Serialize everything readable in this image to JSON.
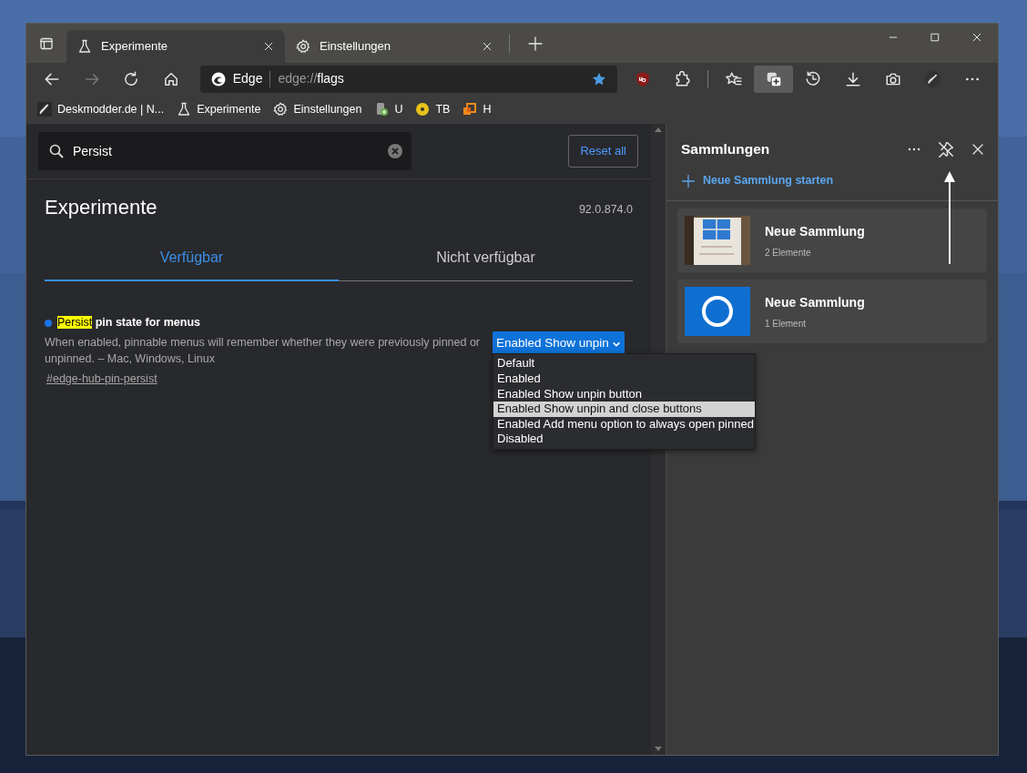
{
  "window": {
    "tabs": [
      {
        "label": "Experimente",
        "selected": true
      },
      {
        "label": "Einstellungen",
        "selected": false
      }
    ]
  },
  "toolbar": {
    "brand": "Edge",
    "url_prefix": "edge://",
    "url_path": "flags",
    "favorite": true,
    "collections_active": true
  },
  "bookmarks": [
    {
      "label": "Deskmodder.de | N..."
    },
    {
      "label": "Experimente"
    },
    {
      "label": "Einstellungen"
    },
    {
      "label": "U"
    },
    {
      "label": "TB"
    },
    {
      "label": "H"
    }
  ],
  "flags": {
    "search": {
      "value": "Persist"
    },
    "reset": "Reset all",
    "title": "Experimente",
    "version": "92.0.874.0",
    "tabs": [
      {
        "label": "Verfügbar",
        "selected": true
      },
      {
        "label": "Nicht verfügbar",
        "selected": false
      }
    ],
    "experiment": {
      "color": "#1a73e8",
      "title_parts": [
        {
          "text": "Persist",
          "highlighted": true
        },
        {
          "text": " pin state for menus",
          "highlighted": false
        }
      ],
      "description": "When enabled, pinnable menus will remember whether they were previously pinned or unpinned. – Mac, Windows, Linux",
      "link": "#edge-hub-pin-persist",
      "select_value": "Enabled Show unpin",
      "options": [
        {
          "label": "Default",
          "selected": false
        },
        {
          "label": "Enabled",
          "selected": false
        },
        {
          "label": "Enabled Show unpin button",
          "selected": false
        },
        {
          "label": "Enabled Show unpin and close buttons",
          "selected": true
        },
        {
          "label": "Enabled Add menu option to always open pinned",
          "selected": false
        },
        {
          "label": "Disabled",
          "selected": false
        }
      ]
    }
  },
  "sidebar": {
    "title": "Sammlungen",
    "new_collection": "Neue Sammlung starten",
    "pinned": false,
    "collections": [
      {
        "name": "Neue Sammlung",
        "count": "2 Elemente"
      },
      {
        "name": "Neue Sammlung",
        "count": "1 Element"
      }
    ]
  }
}
